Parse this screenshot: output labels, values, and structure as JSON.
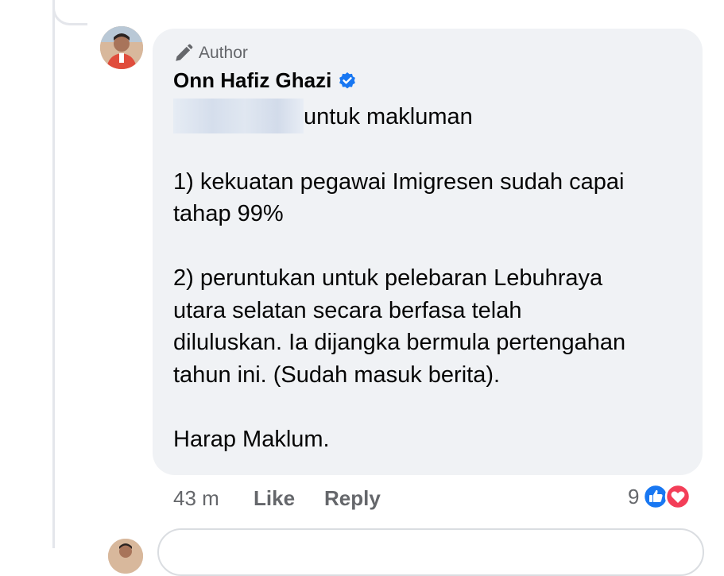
{
  "comment": {
    "author_badge": "Author",
    "author_name": "Onn Hafiz Ghazi",
    "paragraphs": [
      {
        "lines": [
          "untuk makluman"
        ]
      },
      {
        "lines": [
          "1) kekuatan pegawai Imigresen sudah capai",
          "tahap 99%"
        ]
      },
      {
        "lines": [
          "2) peruntukan untuk pelebaran Lebuhraya",
          "utara selatan secara berfasa telah",
          "diluluskan. Ia dijangka bermula pertengahan",
          "tahun ini. (Sudah masuk berita)."
        ]
      },
      {
        "lines": [
          "Harap Maklum."
        ]
      }
    ],
    "timestamp": "43 m",
    "like_label": "Like",
    "reply_label": "Reply",
    "reaction_count": "9",
    "reactions": [
      "like-icon",
      "love-icon"
    ]
  },
  "colors": {
    "bubble_bg": "#f0f2f5",
    "verified_blue": "#1877f2",
    "like_blue": "#1877f2",
    "love_red": "#f33e58",
    "secondary_text": "#65676b"
  }
}
